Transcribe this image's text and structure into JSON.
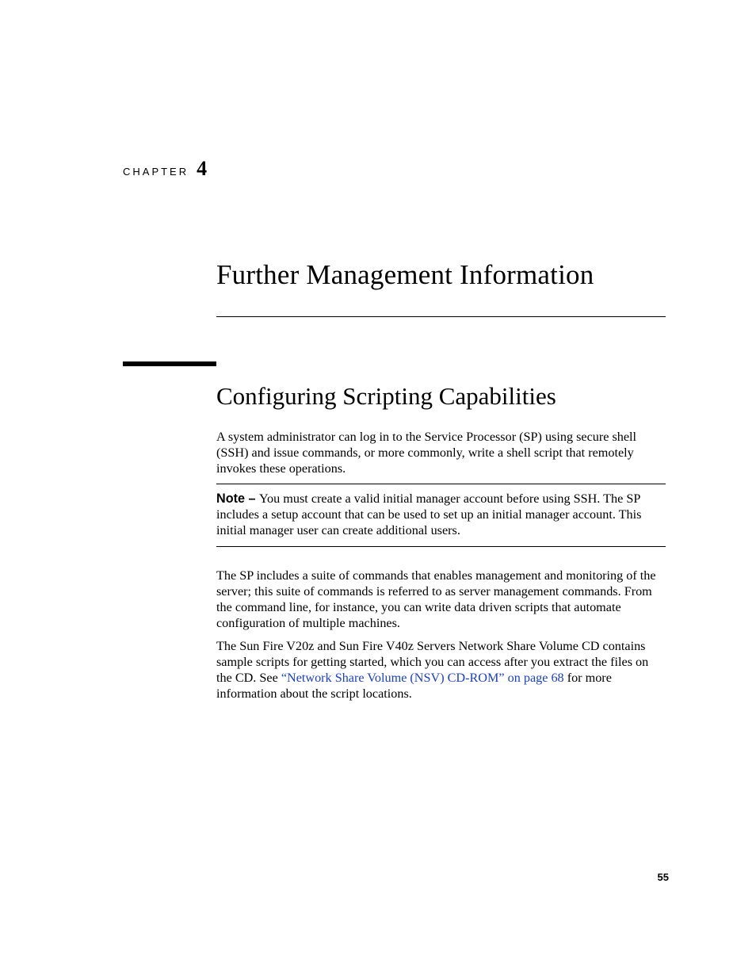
{
  "chapter": {
    "label": "CHAPTER",
    "number": "4"
  },
  "title": "Further Management Information",
  "section_heading": "Configuring Scripting Capabilities",
  "paragraphs": {
    "intro": "A system administrator can log in to the Service Processor (SP) using secure shell (SSH) and issue commands, or more commonly, write a shell script that remotely invokes these operations.",
    "note_label": "Note – ",
    "note_body": "You must create a valid initial manager account before using SSH. The SP includes a setup account that can be used to set up an initial manager account. This initial manager user can create additional users.",
    "suite": "The SP includes a suite of commands that enables management and monitoring of the server; this suite of commands is referred to as server management commands. From the command line, for instance, you can write data driven scripts that automate configuration of multiple machines.",
    "cd_pre": "The Sun Fire V20z and Sun Fire V40z Servers Network Share Volume CD contains sample scripts for getting started, which you can access after you extract the files on the CD. See ",
    "cd_link": "“Network Share Volume (NSV) CD-ROM” on page 68",
    "cd_post": " for more information about the script locations."
  },
  "page_number": "55"
}
